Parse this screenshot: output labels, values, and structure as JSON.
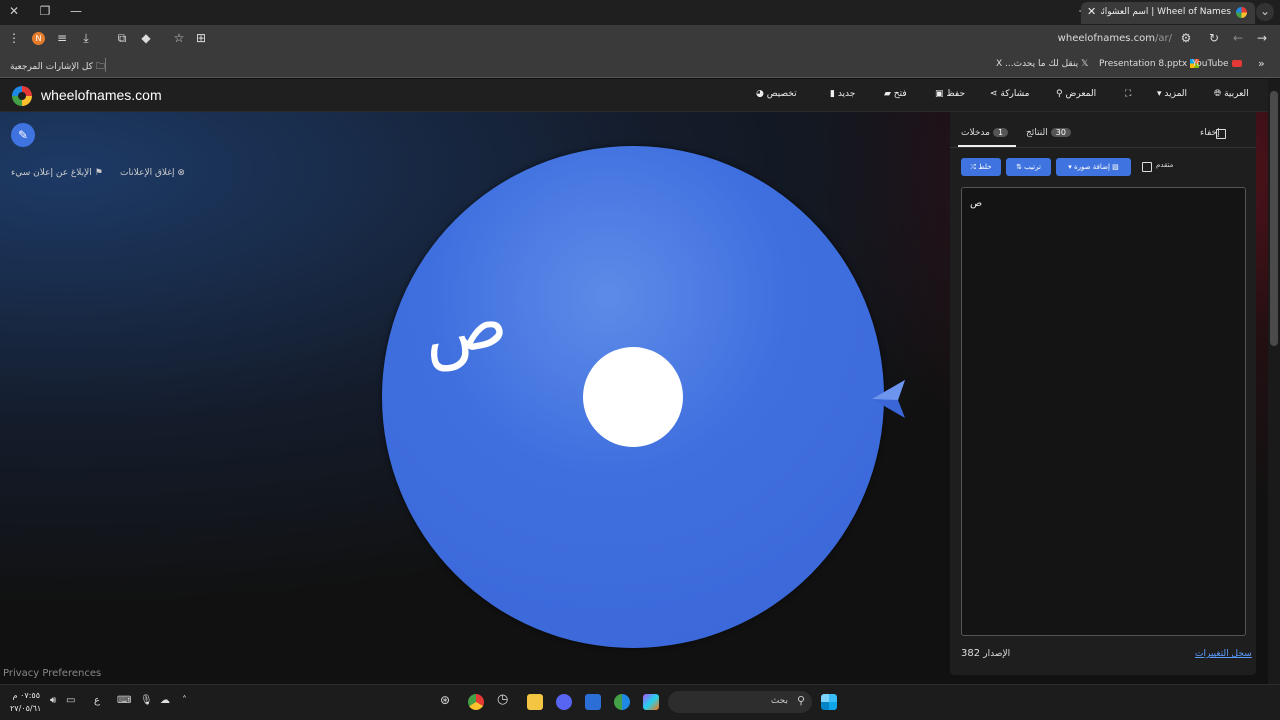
{
  "browser": {
    "tab_title": "Wheel of Names | اسم العشوائي",
    "tab_close": "✕",
    "window_controls": {
      "close": "✕",
      "restore": "❐",
      "minimize": "—"
    },
    "url_host": "wheelofnames.com",
    "url_path": "/ar/",
    "bookmarks": {
      "all_bookmarks": "كل الإشارات المرجعية",
      "x_item": "X ...ينقل لك ما يحدث",
      "presentation": "Presentation 8.pptx",
      "youtube": "YouTube"
    },
    "avatar_letter": "N"
  },
  "site": {
    "name": "wheelofnames.com",
    "nav": {
      "language": "العربية",
      "more": "المزيد",
      "gallery": "المعرض",
      "share": "مشاركة",
      "save": "حفظ",
      "open": "فتح",
      "new": "جديد",
      "customize": "تخصيص"
    },
    "ads": {
      "close_ads": "إغلاق الإعلانات",
      "report_ad": "الإبلاغ عن إعلان سيء"
    },
    "privacy": "Privacy Preferences",
    "wheel": {
      "entry_label": "ص",
      "color": "#3f6fdf"
    },
    "panel": {
      "hide_label": "إخفاء",
      "tab_entries": "مدخلات",
      "tab_entries_count": "1",
      "tab_results": "النتائج",
      "tab_results_count": "30",
      "advanced_label": "متقدم",
      "add_image": "إضافة صورة",
      "sort": "ترتيب",
      "shuffle": "خلط",
      "entries_text": "ص",
      "changelog": "سجل التغييرات",
      "version_label": "الإصدار",
      "version_number": "382"
    }
  },
  "taskbar": {
    "search_label": "بحث",
    "time": "٠٧:٥٥ م",
    "date": "٢٧/٠٥/٦١",
    "lang_indicator": "ع"
  }
}
